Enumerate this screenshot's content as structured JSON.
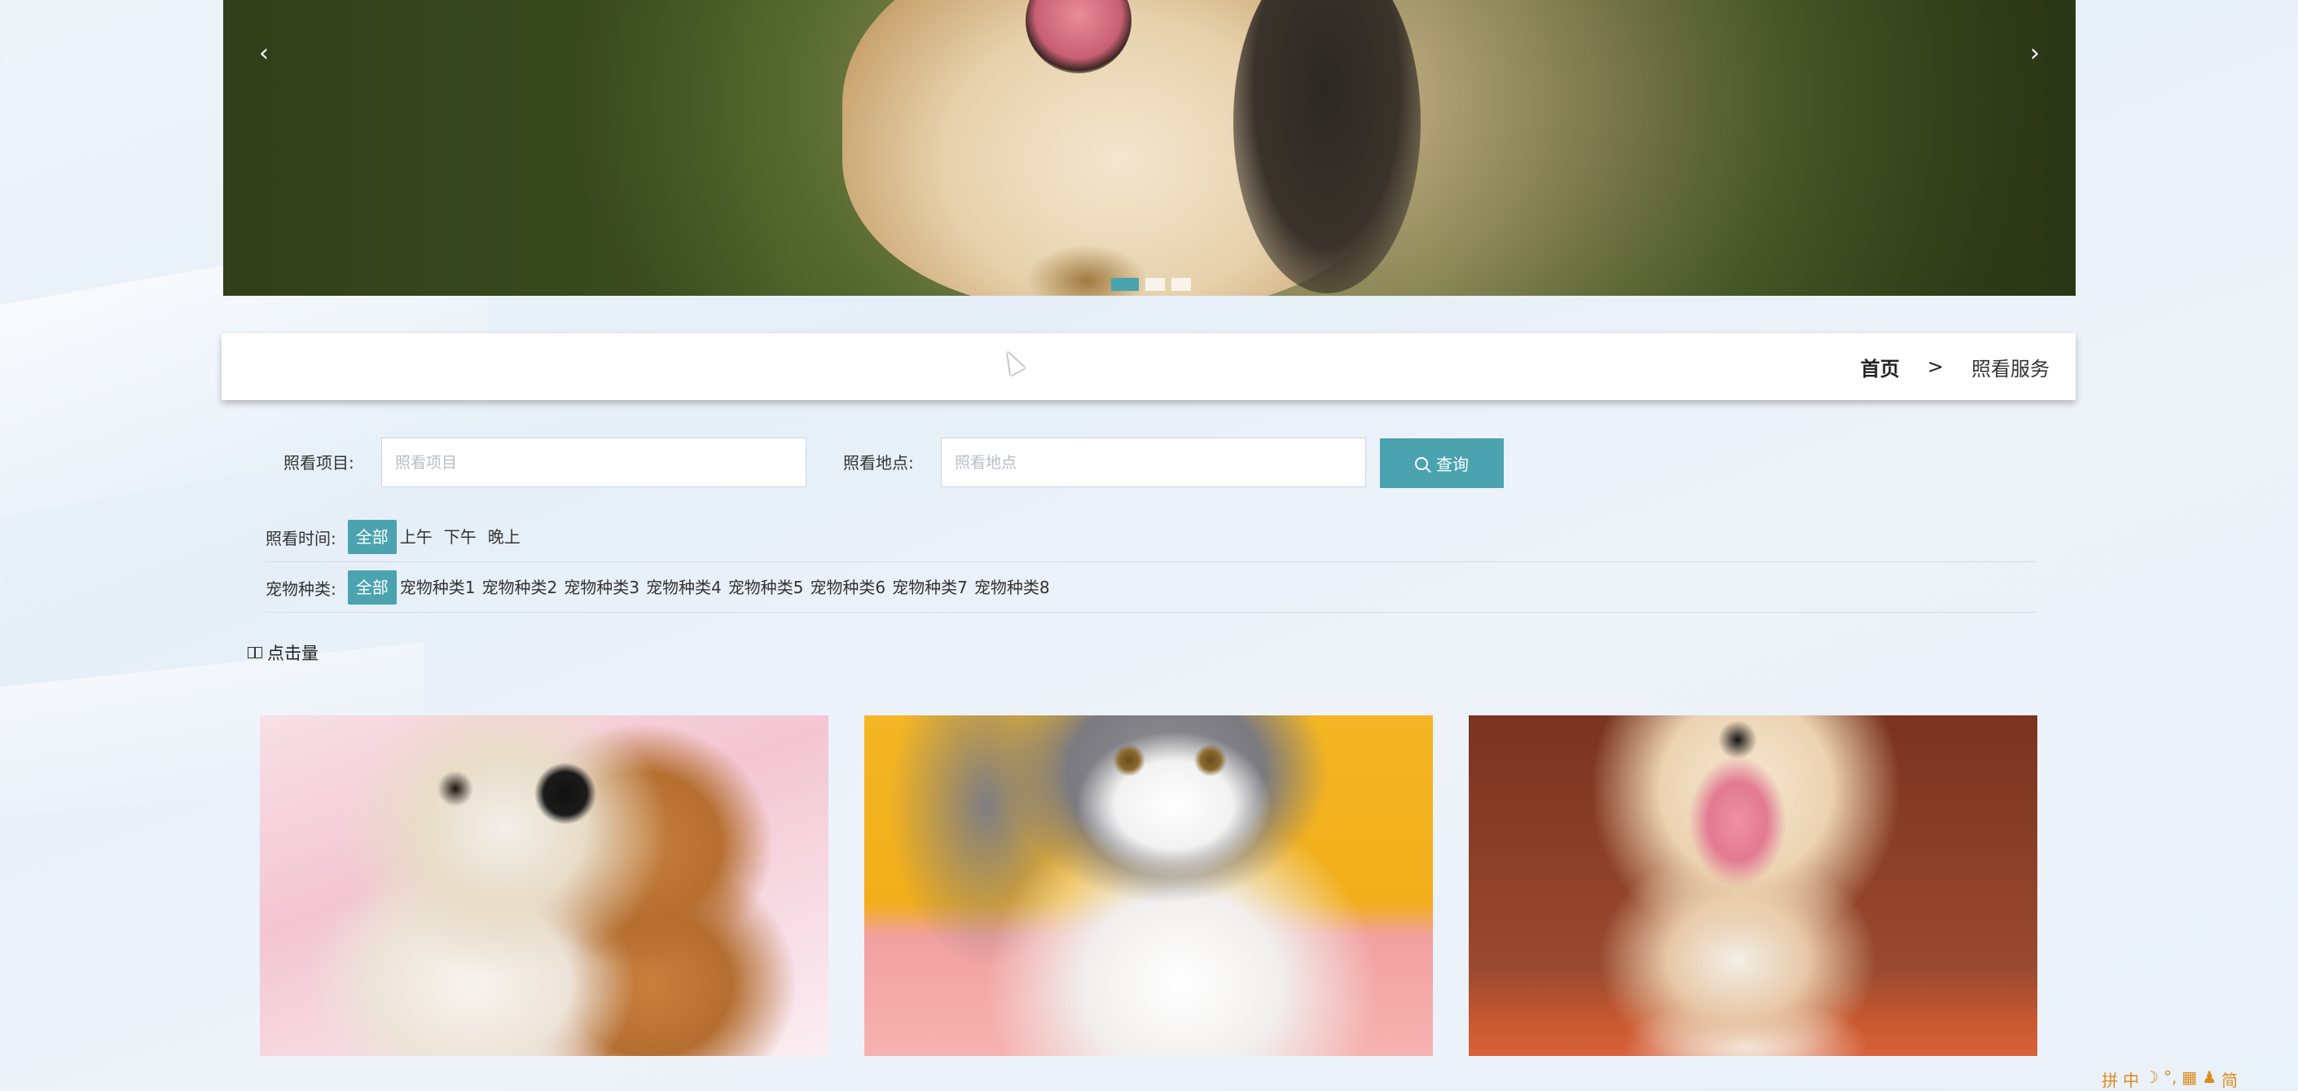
{
  "banner": {
    "prev_glyph": "‹",
    "next_glyph": "›",
    "slides_count": 3,
    "active_slide": 1
  },
  "breadcrumb": {
    "home": "首页",
    "separator": ">",
    "current": "照看服务"
  },
  "search": {
    "project_label": "照看项目:",
    "project_placeholder": "照看项目",
    "location_label": "照看地点:",
    "location_placeholder": "照看地点",
    "button_label": "查询"
  },
  "filters": {
    "time": {
      "label": "照看时间:",
      "options": [
        "全部",
        "上午",
        "下午",
        "晚上"
      ],
      "active": "全部"
    },
    "species": {
      "label": "宠物种类:",
      "options": [
        "全部",
        "宠物种类1",
        "宠物种类2",
        "宠物种类3",
        "宠物种类4",
        "宠物种类5",
        "宠物种类6",
        "宠物种类7",
        "宠物种类8"
      ],
      "active": "全部"
    }
  },
  "sort": {
    "label": "点击量"
  },
  "ime_bar": [
    "拼",
    "中",
    "☽",
    "°,",
    "▦",
    "♟",
    "简"
  ],
  "colors": {
    "accent": "#4aa3ae"
  }
}
